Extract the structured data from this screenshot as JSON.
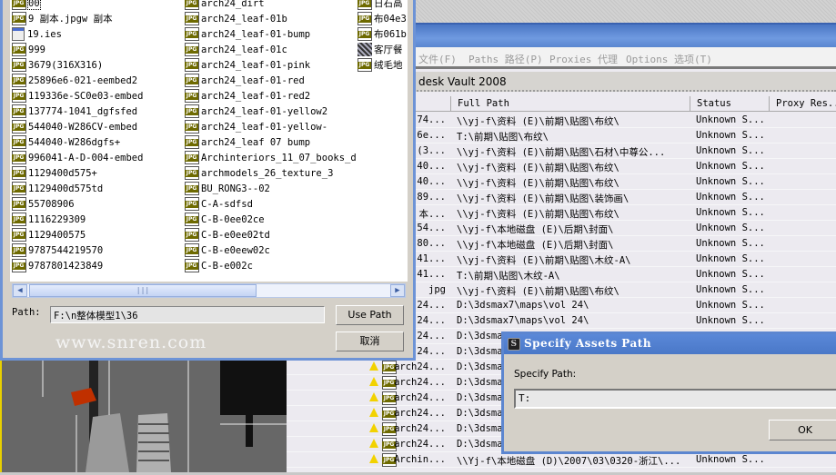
{
  "background_window": {
    "menu": [
      "文件(F)",
      "Paths 路径(P)",
      "Proxies 代理",
      "Options 选项(T)"
    ],
    "vault_label": "desk Vault 2008",
    "columns": [
      "Full Path",
      "Status",
      "Proxy Res.."
    ],
    "rows": [
      {
        "name": "74...",
        "path": "\\\\yj-f\\资料 (E)\\前期\\贴图\\布纹\\",
        "status": "Unknown S..."
      },
      {
        "name": "6e...",
        "path": "T:\\前期\\贴图\\布纹\\",
        "status": "Unknown S..."
      },
      {
        "name": "(3...",
        "path": "\\\\yj-f\\资料 (E)\\前期\\贴图\\石材\\中尊公...",
        "status": "Unknown S..."
      },
      {
        "name": "40...",
        "path": "\\\\yj-f\\资料 (E)\\前期\\贴图\\布纹\\",
        "status": "Unknown S..."
      },
      {
        "name": "40...",
        "path": "\\\\yj-f\\资料 (E)\\前期\\贴图\\布纹\\",
        "status": "Unknown S..."
      },
      {
        "name": "89...",
        "path": "\\\\yj-f\\资料 (E)\\前期\\贴图\\装饰画\\",
        "status": "Unknown S..."
      },
      {
        "name": "本...",
        "path": "\\\\yj-f\\资料 (E)\\前期\\贴图\\布纹\\",
        "status": "Unknown S..."
      },
      {
        "name": "54...",
        "path": "\\\\yj-f\\本地磁盘 (E)\\后期\\封面\\",
        "status": "Unknown S..."
      },
      {
        "name": "80...",
        "path": "\\\\yj-f\\本地磁盘 (E)\\后期\\封面\\",
        "status": "Unknown S..."
      },
      {
        "name": "41...",
        "path": "\\\\yj-f\\资料 (E)\\前期\\贴图\\木纹-A\\",
        "status": "Unknown S..."
      },
      {
        "name": "41...",
        "path": "T:\\前期\\贴图\\木纹-A\\",
        "status": "Unknown S..."
      },
      {
        "name": "jpg",
        "path": "\\\\yj-f\\资料 (E)\\前期\\贴图\\布纹\\",
        "status": "Unknown S..."
      },
      {
        "name": "24...",
        "path": "D:\\3dsmax7\\maps\\vol 24\\",
        "status": "Unknown S..."
      },
      {
        "name": "24...",
        "path": "D:\\3dsmax7\\maps\\vol 24\\",
        "status": "Unknown S..."
      },
      {
        "name": "24...",
        "path": "D:\\3dsma",
        "status": ""
      },
      {
        "name": "24...",
        "path": "D:\\3dsma",
        "status": ""
      },
      {
        "name": "arch24...",
        "path": "D:\\3dsma",
        "status": ""
      },
      {
        "name": "arch24...",
        "path": "D:\\3dsma",
        "status": ""
      },
      {
        "name": "arch24...",
        "path": "D:\\3dsma",
        "status": ""
      },
      {
        "name": "arch24...",
        "path": "D:\\3dsma",
        "status": ""
      },
      {
        "name": "arch24...",
        "path": "D:\\3dsma",
        "status": ""
      },
      {
        "name": "arch24...",
        "path": "D:\\3dsma",
        "status": ""
      },
      {
        "name": "Archin...",
        "path": "\\\\Yj-f\\本地磁盘 (D)\\2007\\03\\0320-浙江\\...",
        "status": "Unknown S..."
      }
    ]
  },
  "file_dialog": {
    "columns": [
      [
        "00",
        "9 副本.jpgw 副本",
        "19.ies",
        "999",
        "3679(316X316)",
        "25896e6-021-eembed2",
        "119336e-SC0e03-embed",
        "137774-1041_dgfsfed",
        "544040-W286CV-embed",
        "544040-W286dgfs+",
        "996041-A-D-004-embed",
        "1129400d575+",
        "1129400d575td",
        "55708906",
        "1116229309",
        "1129400575",
        "9787544219570",
        "9787801423849"
      ],
      [
        "arch24_dirt",
        "arch24_leaf-01b",
        "arch24_leaf-01-bump",
        "arch24_leaf-01c",
        "arch24_leaf-01-pink",
        "arch24_leaf-01-red",
        "arch24_leaf-01-red2",
        "arch24_leaf-01-yellow2",
        "arch24_leaf-01-yellow-",
        "arch24_leaf 07 bump",
        "Archinteriors_11_07_books_d",
        "archmodels_26_texture_3",
        "BU_RONG3--02",
        "C-A-sdfsd",
        "C-B-0ee02ce",
        "C-B-e0ee02td",
        "C-B-e0eew02c",
        "C-B-e002c"
      ],
      [
        "日石高",
        "布04e3",
        "布061b",
        "客厅餐",
        "绒毛地"
      ]
    ],
    "path_label": "Path:",
    "path_value": "F:\\n整体模型1\\36",
    "use_path": "Use Path",
    "cancel": "取消",
    "watermark": "www.snren.com"
  },
  "specify_dialog": {
    "title": "Specify Assets Path",
    "label": "Specify Path:",
    "value": "T:",
    "ok": "OK"
  }
}
